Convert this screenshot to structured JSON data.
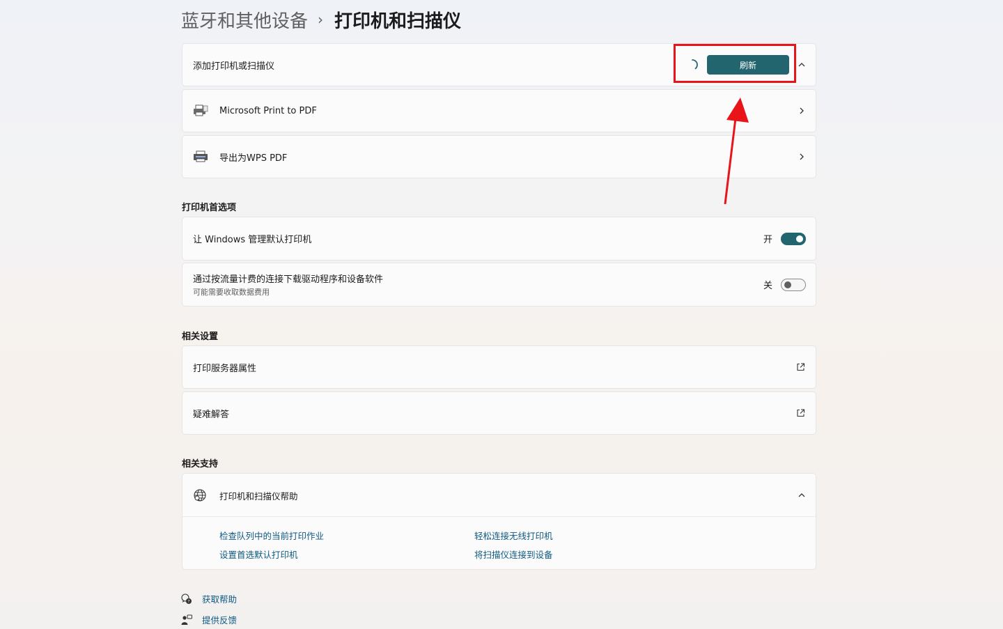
{
  "breadcrumb": {
    "parent": "蓝牙和其他设备",
    "separator": "›",
    "current": "打印机和扫描仪"
  },
  "add_printer": {
    "label": "添加打印机或扫描仪",
    "refresh_label": "刷新"
  },
  "printers": [
    {
      "name": "Microsoft Print to PDF"
    },
    {
      "name": "导出为WPS PDF"
    }
  ],
  "printer_prefs": {
    "title": "打印机首选项",
    "items": [
      {
        "label": "让 Windows 管理默认打印机",
        "state": "开",
        "on": true
      },
      {
        "label": "通过按流量计费的连接下载驱动程序和设备软件",
        "sublabel": "可能需要收取数据费用",
        "state": "关",
        "on": false
      }
    ]
  },
  "related_settings": {
    "title": "相关设置",
    "items": [
      {
        "label": "打印服务器属性"
      },
      {
        "label": "疑难解答"
      }
    ]
  },
  "related_support": {
    "title": "相关支持",
    "help_title": "打印机和扫描仪帮助",
    "links": [
      "检查队列中的当前打印作业",
      "轻松连接无线打印机",
      "设置首选默认打印机",
      "将扫描仪连接到设备"
    ]
  },
  "footer": {
    "get_help": "获取帮助",
    "feedback": "提供反馈"
  },
  "colors": {
    "accent": "#22656f",
    "highlight": "#e8141a",
    "link": "#0f5a83"
  }
}
